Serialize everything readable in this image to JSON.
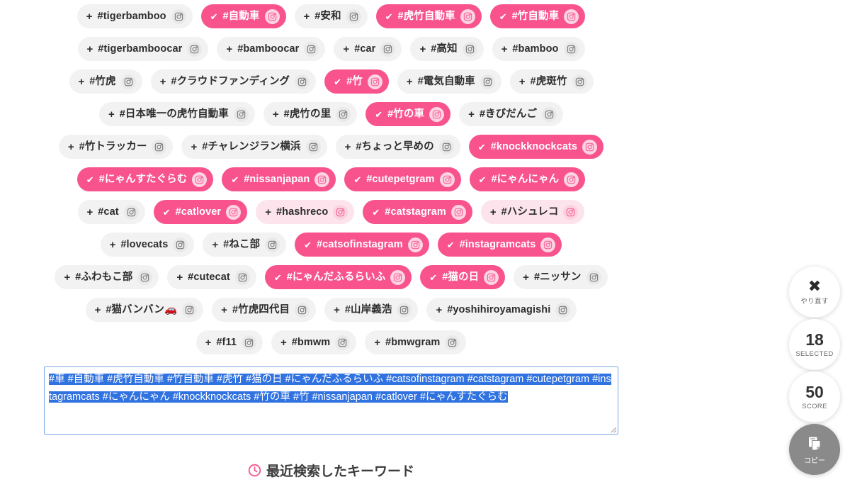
{
  "tag_rows": [
    [
      {
        "label": "#tigerbamboo",
        "state": "default"
      },
      {
        "label": "#自動車",
        "state": "selected"
      },
      {
        "label": "#安和",
        "state": "default"
      },
      {
        "label": "#虎竹自動車",
        "state": "selected"
      },
      {
        "label": "#竹自動車",
        "state": "selected"
      }
    ],
    [
      {
        "label": "#tigerbamboocar",
        "state": "default"
      },
      {
        "label": "#bamboocar",
        "state": "default"
      },
      {
        "label": "#car",
        "state": "default"
      },
      {
        "label": "#高知",
        "state": "default"
      },
      {
        "label": "#bamboo",
        "state": "default"
      }
    ],
    [
      {
        "label": "#竹虎",
        "state": "default"
      },
      {
        "label": "#クラウドファンディング",
        "state": "default"
      },
      {
        "label": "#竹",
        "state": "selected"
      },
      {
        "label": "#電気自動車",
        "state": "default"
      },
      {
        "label": "#虎斑竹",
        "state": "default"
      }
    ],
    [
      {
        "label": "#日本唯一の虎竹自動車",
        "state": "default"
      },
      {
        "label": "#虎竹の里",
        "state": "default"
      },
      {
        "label": "#竹の車",
        "state": "selected"
      },
      {
        "label": "#きびだんご",
        "state": "default"
      }
    ],
    [
      {
        "label": "#竹トラッカー",
        "state": "default"
      },
      {
        "label": "#チャレンジラン横浜",
        "state": "default"
      },
      {
        "label": "#ちょっと早めの",
        "state": "default"
      },
      {
        "label": "#knockknockcats",
        "state": "selected"
      }
    ],
    [
      {
        "label": "#にゃんすたぐらむ",
        "state": "selected"
      },
      {
        "label": "#nissanjapan",
        "state": "selected"
      },
      {
        "label": "#cutepetgram",
        "state": "selected"
      },
      {
        "label": "#にゃんにゃん",
        "state": "selected"
      }
    ],
    [
      {
        "label": "#cat",
        "state": "default"
      },
      {
        "label": "#catlover",
        "state": "selected"
      },
      {
        "label": "#hashreco",
        "state": "reco"
      },
      {
        "label": "#catstagram",
        "state": "selected"
      },
      {
        "label": "#ハシュレコ",
        "state": "reco"
      }
    ],
    [
      {
        "label": "#lovecats",
        "state": "default"
      },
      {
        "label": "#ねこ部",
        "state": "default"
      },
      {
        "label": "#catsofinstagram",
        "state": "selected"
      },
      {
        "label": "#instagramcats",
        "state": "selected"
      }
    ],
    [
      {
        "label": "#ふわもこ部",
        "state": "default"
      },
      {
        "label": "#cutecat",
        "state": "default"
      },
      {
        "label": "#にゃんだふるらいふ",
        "state": "selected"
      },
      {
        "label": "#猫の日",
        "state": "selected"
      },
      {
        "label": "#ニッサン",
        "state": "default"
      }
    ],
    [
      {
        "label": "#猫バンバン🚗",
        "state": "default"
      },
      {
        "label": "#竹虎四代目",
        "state": "default"
      },
      {
        "label": "#山岸義浩",
        "state": "default"
      },
      {
        "label": "#yoshihiroyamagishi",
        "state": "default"
      }
    ],
    [
      {
        "label": "#f11",
        "state": "default"
      },
      {
        "label": "#bmwm",
        "state": "default"
      },
      {
        "label": "#bmwgram",
        "state": "default"
      }
    ]
  ],
  "icons": {
    "add": "+",
    "check": "✔",
    "instagram": "instagram-icon",
    "close": "✖",
    "clock": "clock-icon",
    "copy": "copy-icon"
  },
  "output": {
    "selected_text": "#車 #自動車 #虎竹自動車 #竹自動車 #虎竹 #猫の日 #にゃんだふるらいふ #catsofinstagram #catstagram #cutepetgram #instagramcats #にゃんにゃん #knockknockcats #竹の車 #竹 #nissanjapan #catlover #にゃんすたぐらむ",
    "placeholder": ""
  },
  "recent": {
    "title": "最近検索したキーワード"
  },
  "rail": {
    "reset": {
      "glyph": "✖",
      "caption": "やり直す"
    },
    "selected": {
      "value": "18",
      "caption": "SELECTED"
    },
    "score": {
      "value": "50",
      "caption": "SCORE"
    },
    "copy": {
      "caption": "コピー"
    }
  },
  "colors": {
    "accent_pink": "#f8538d",
    "light_pink": "#fde3ec",
    "chip_gray": "#f2f2f2",
    "selection_blue": "#3072e0",
    "copy_gray": "#8a8a8a"
  }
}
